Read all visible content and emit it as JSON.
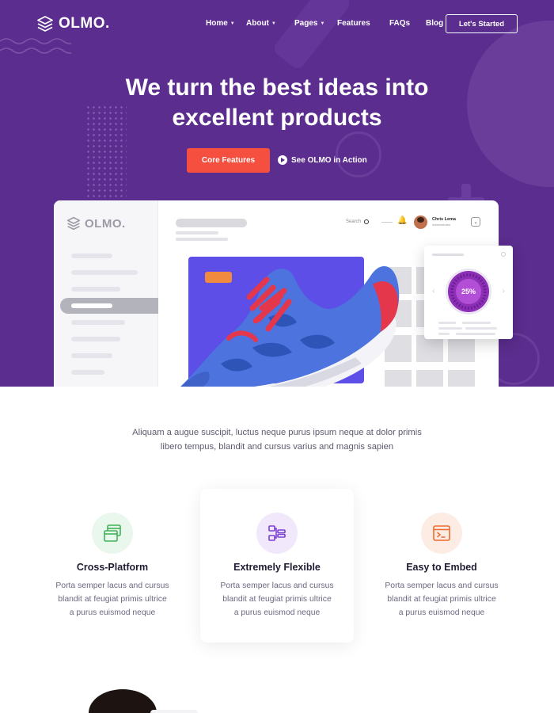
{
  "brand": {
    "name": "OLMO."
  },
  "nav": {
    "items": [
      {
        "label": "Home",
        "has_dropdown": true
      },
      {
        "label": "About",
        "has_dropdown": true
      },
      {
        "label": "Pages",
        "has_dropdown": true
      },
      {
        "label": "Features",
        "has_dropdown": false
      },
      {
        "label": "FAQs",
        "has_dropdown": false
      },
      {
        "label": "Blog",
        "has_dropdown": false
      }
    ],
    "cta_label": "Let's Started"
  },
  "hero": {
    "headline_line1": "We turn the best ideas into",
    "headline_line2": "excellent products",
    "primary_button": "Core Features",
    "secondary_link": "See OLMO in Action"
  },
  "mockup": {
    "logo_text": "OLMO.",
    "search_label": "Search",
    "user_name": "Chris Lema",
    "user_role": "Administrator",
    "stat_percent": "25%"
  },
  "intro": {
    "line1": "Aliquam a augue suscipit, luctus neque purus ipsum neque at dolor primis",
    "line2": "libero tempus, blandit and cursus varius and magnis sapien"
  },
  "features": [
    {
      "title": "Cross-Platform",
      "desc_line1": "Porta semper lacus and cursus",
      "desc_line2": "blandit at feugiat primis ultrice",
      "desc_line3": "a purus euismod neque",
      "icon": "windows-stack-icon",
      "icon_color": "#3fb35a",
      "icon_bg": "#eaf7ec"
    },
    {
      "title": "Extremely Flexible",
      "desc_line1": "Porta semper lacus and cursus",
      "desc_line2": "blandit at feugiat primis ultrice",
      "desc_line3": "a purus euismod neque",
      "icon": "flow-structure-icon",
      "icon_color": "#7a3fcf",
      "icon_bg": "#f1e9fb"
    },
    {
      "title": "Easy to Embed",
      "desc_line1": "Porta semper lacus and cursus",
      "desc_line2": "blandit at feugiat primis ultrice",
      "desc_line3": "a purus euismod neque",
      "icon": "terminal-window-icon",
      "icon_color": "#f06b2f",
      "icon_bg": "#fdece4"
    }
  ],
  "colors": {
    "hero_bg": "#5b2d8e",
    "accent_red": "#f5503f",
    "text_dark": "#1f1c33"
  }
}
